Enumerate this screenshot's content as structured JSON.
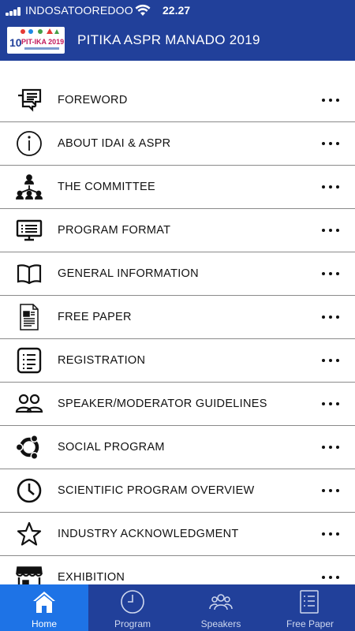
{
  "status_bar": {
    "carrier": "INDOSATOOREDOO",
    "time": "22.27"
  },
  "header": {
    "logo_number": "10",
    "logo_text": "PIT-IKA 2019",
    "title": "PITIKA ASPR MANADO 2019"
  },
  "menu": [
    {
      "label": "FOREWORD",
      "icon": "chat-bubbles-icon"
    },
    {
      "label": "ABOUT IDAI & ASPR",
      "icon": "info-icon"
    },
    {
      "label": "THE COMMITTEE",
      "icon": "org-chart-icon"
    },
    {
      "label": "PROGRAM FORMAT",
      "icon": "monitor-list-icon"
    },
    {
      "label": "GENERAL INFORMATION",
      "icon": "open-book-icon"
    },
    {
      "label": "FREE PAPER",
      "icon": "document-icon"
    },
    {
      "label": "REGISTRATION",
      "icon": "checklist-icon"
    },
    {
      "label": "SPEAKER/MODERATOR GUIDELINES",
      "icon": "people-icon"
    },
    {
      "label": "SOCIAL PROGRAM",
      "icon": "ubuntu-icon"
    },
    {
      "label": "SCIENTIFIC PROGRAM OVERVIEW",
      "icon": "clock-icon"
    },
    {
      "label": "INDUSTRY ACKNOWLEDGMENT",
      "icon": "star-icon"
    },
    {
      "label": "EXHIBITION",
      "icon": "storefront-icon"
    }
  ],
  "tabs": [
    {
      "label": "Home",
      "icon": "home-icon",
      "active": true
    },
    {
      "label": "Program",
      "icon": "clock-icon",
      "active": false
    },
    {
      "label": "Speakers",
      "icon": "people-icon",
      "active": false
    },
    {
      "label": "Free Paper",
      "icon": "list-icon",
      "active": false
    }
  ],
  "colors": {
    "header_bg": "#21409a",
    "tab_active": "#1e73e6",
    "text": "#111111"
  }
}
